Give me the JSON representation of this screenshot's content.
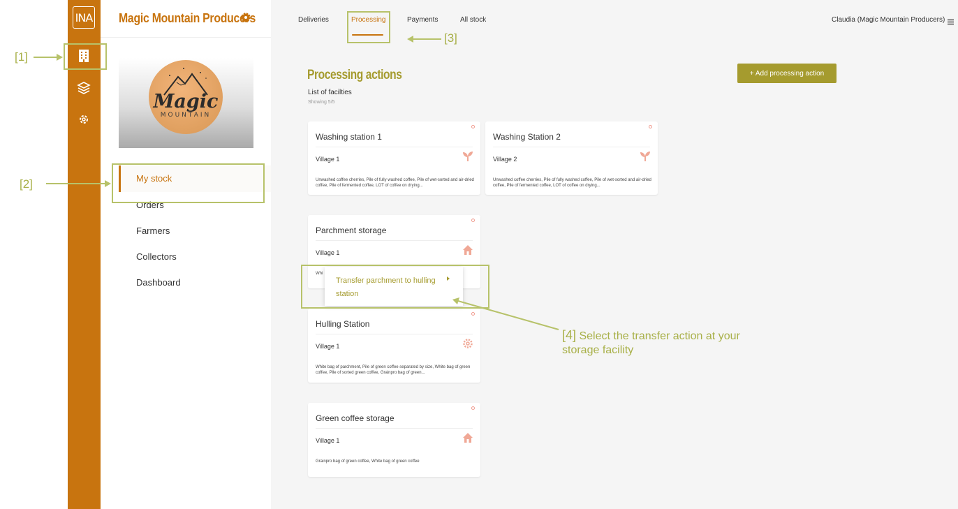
{
  "rail": {
    "logo_text": "INA",
    "icons": [
      "building-icon",
      "layers-icon",
      "gear-icon"
    ]
  },
  "sidebar": {
    "org_name": "Magic Mountain Producers",
    "logo_word": "Magic",
    "logo_sub": "MOUNTAIN",
    "items": [
      {
        "label": "My stock",
        "active": true
      },
      {
        "label": "Orders"
      },
      {
        "label": "Farmers"
      },
      {
        "label": "Collectors"
      },
      {
        "label": "Dashboard"
      }
    ]
  },
  "topbar": {
    "tabs": [
      {
        "label": "Deliveries"
      },
      {
        "label": "Processing",
        "active": true
      },
      {
        "label": "Payments"
      },
      {
        "label": "All stock"
      }
    ],
    "user": "Claudia (Magic Mountain Producers)"
  },
  "main": {
    "title": "Processing actions",
    "list_label": "List of facilties",
    "showing": "Showing 5/5",
    "add_button": "+ Add processing action",
    "cards": [
      {
        "title": "Washing station 1",
        "place": "Village 1",
        "icon": "sprout-icon",
        "desc": "Unwashed coffee cherries, Pile of fully washed coffee, Pile of wet-sorted and air-dried coffee, Pile of fermented coffee, LOT of coffee on drying..."
      },
      {
        "title": "Washing Station 2",
        "place": "Village 2",
        "icon": "sprout-icon",
        "desc": "Unwashed coffee cherries, Pile of fully washed coffee, Pile of wet-sorted and air-dried coffee, Pile of fermented coffee, LOT of coffee on drying..."
      },
      {
        "title": "Parchment storage",
        "place": "Village 1",
        "icon": "home-icon",
        "desc": "Whi"
      },
      {
        "title": "Hulling Station",
        "place": "Village 1",
        "icon": "gear-icon",
        "desc": "White bag of parchment, Pile of green coffee separated by size, White bag of green coffee, Pile of sorted green coffee, Grainpro bag of green..."
      },
      {
        "title": "Green coffee storage",
        "place": "Village 1",
        "icon": "home-icon",
        "desc": "Grainpro bag of green coffee, White bag of green coffee"
      }
    ],
    "popup_action": "Transfer parchment to hulling station"
  },
  "annotations": {
    "a1": "[1]",
    "a2": "[2]",
    "a3": "[3]",
    "a4_num": "[4]",
    "a4_text": "Select the transfer action at your storage facility"
  },
  "colors": {
    "brand_orange": "#c8740f",
    "accent_olive": "#a59b2e",
    "annotation_green": "#b7c26a",
    "background": "#f5f5f5"
  }
}
